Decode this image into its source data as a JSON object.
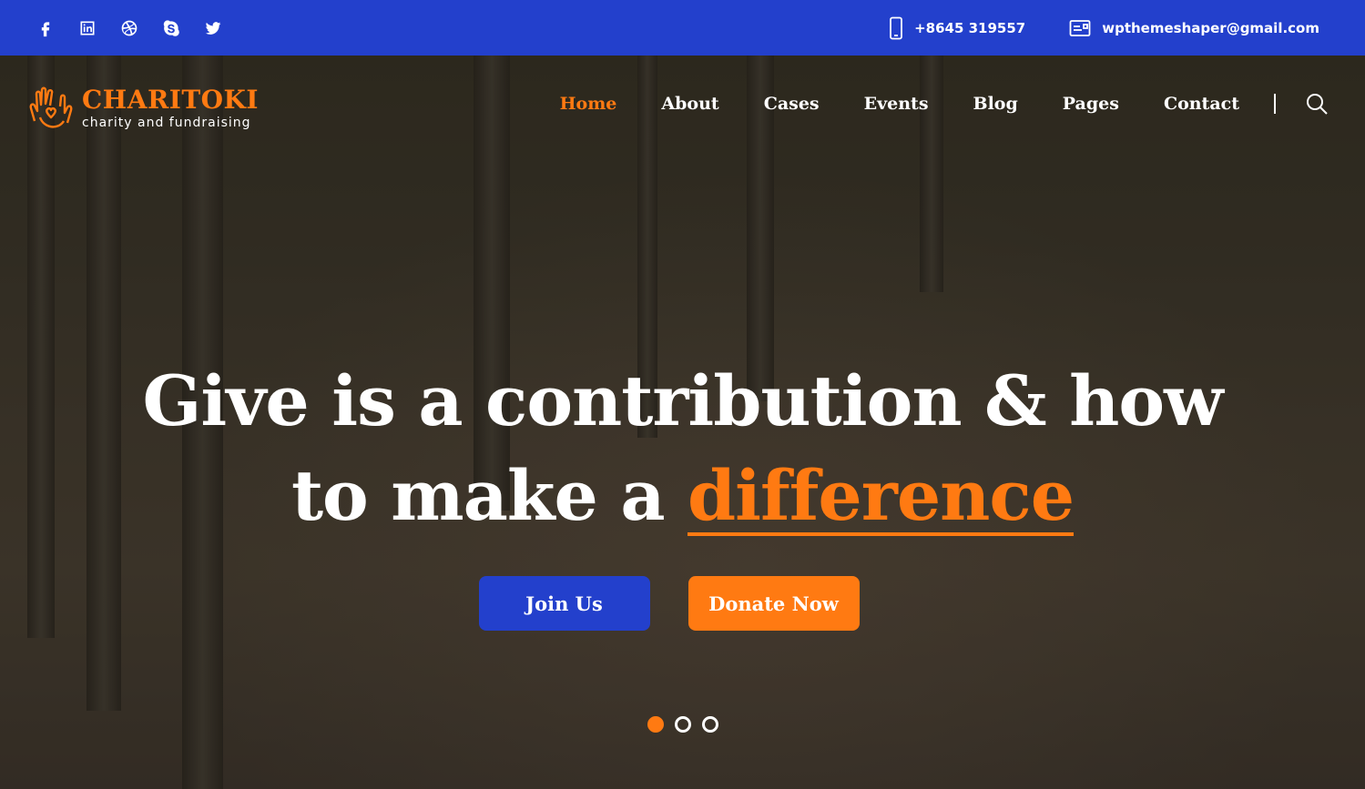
{
  "colors": {
    "primary_blue": "#2340cc",
    "accent_orange": "#ff7a12"
  },
  "topbar": {
    "socials": [
      "facebook-icon",
      "linkedin-icon",
      "dribbble-icon",
      "skype-icon",
      "twitter-icon"
    ],
    "phone": "+8645 319557",
    "email": "wpthemeshaper@gmail.com"
  },
  "logo": {
    "name": "CHARITOKI",
    "tagline": "charity and fundraising"
  },
  "nav": {
    "items": [
      {
        "label": "Home",
        "active": true
      },
      {
        "label": "About"
      },
      {
        "label": "Cases"
      },
      {
        "label": "Events"
      },
      {
        "label": "Blog"
      },
      {
        "label": "Pages"
      },
      {
        "label": "Contact"
      }
    ]
  },
  "hero": {
    "headline_line1": "Give is a contribution & how",
    "headline_line2_prefix": "to make a ",
    "headline_highlight": "difference",
    "join_label": "Join Us",
    "donate_label": "Donate Now",
    "slides": 3,
    "active_slide": 1
  }
}
